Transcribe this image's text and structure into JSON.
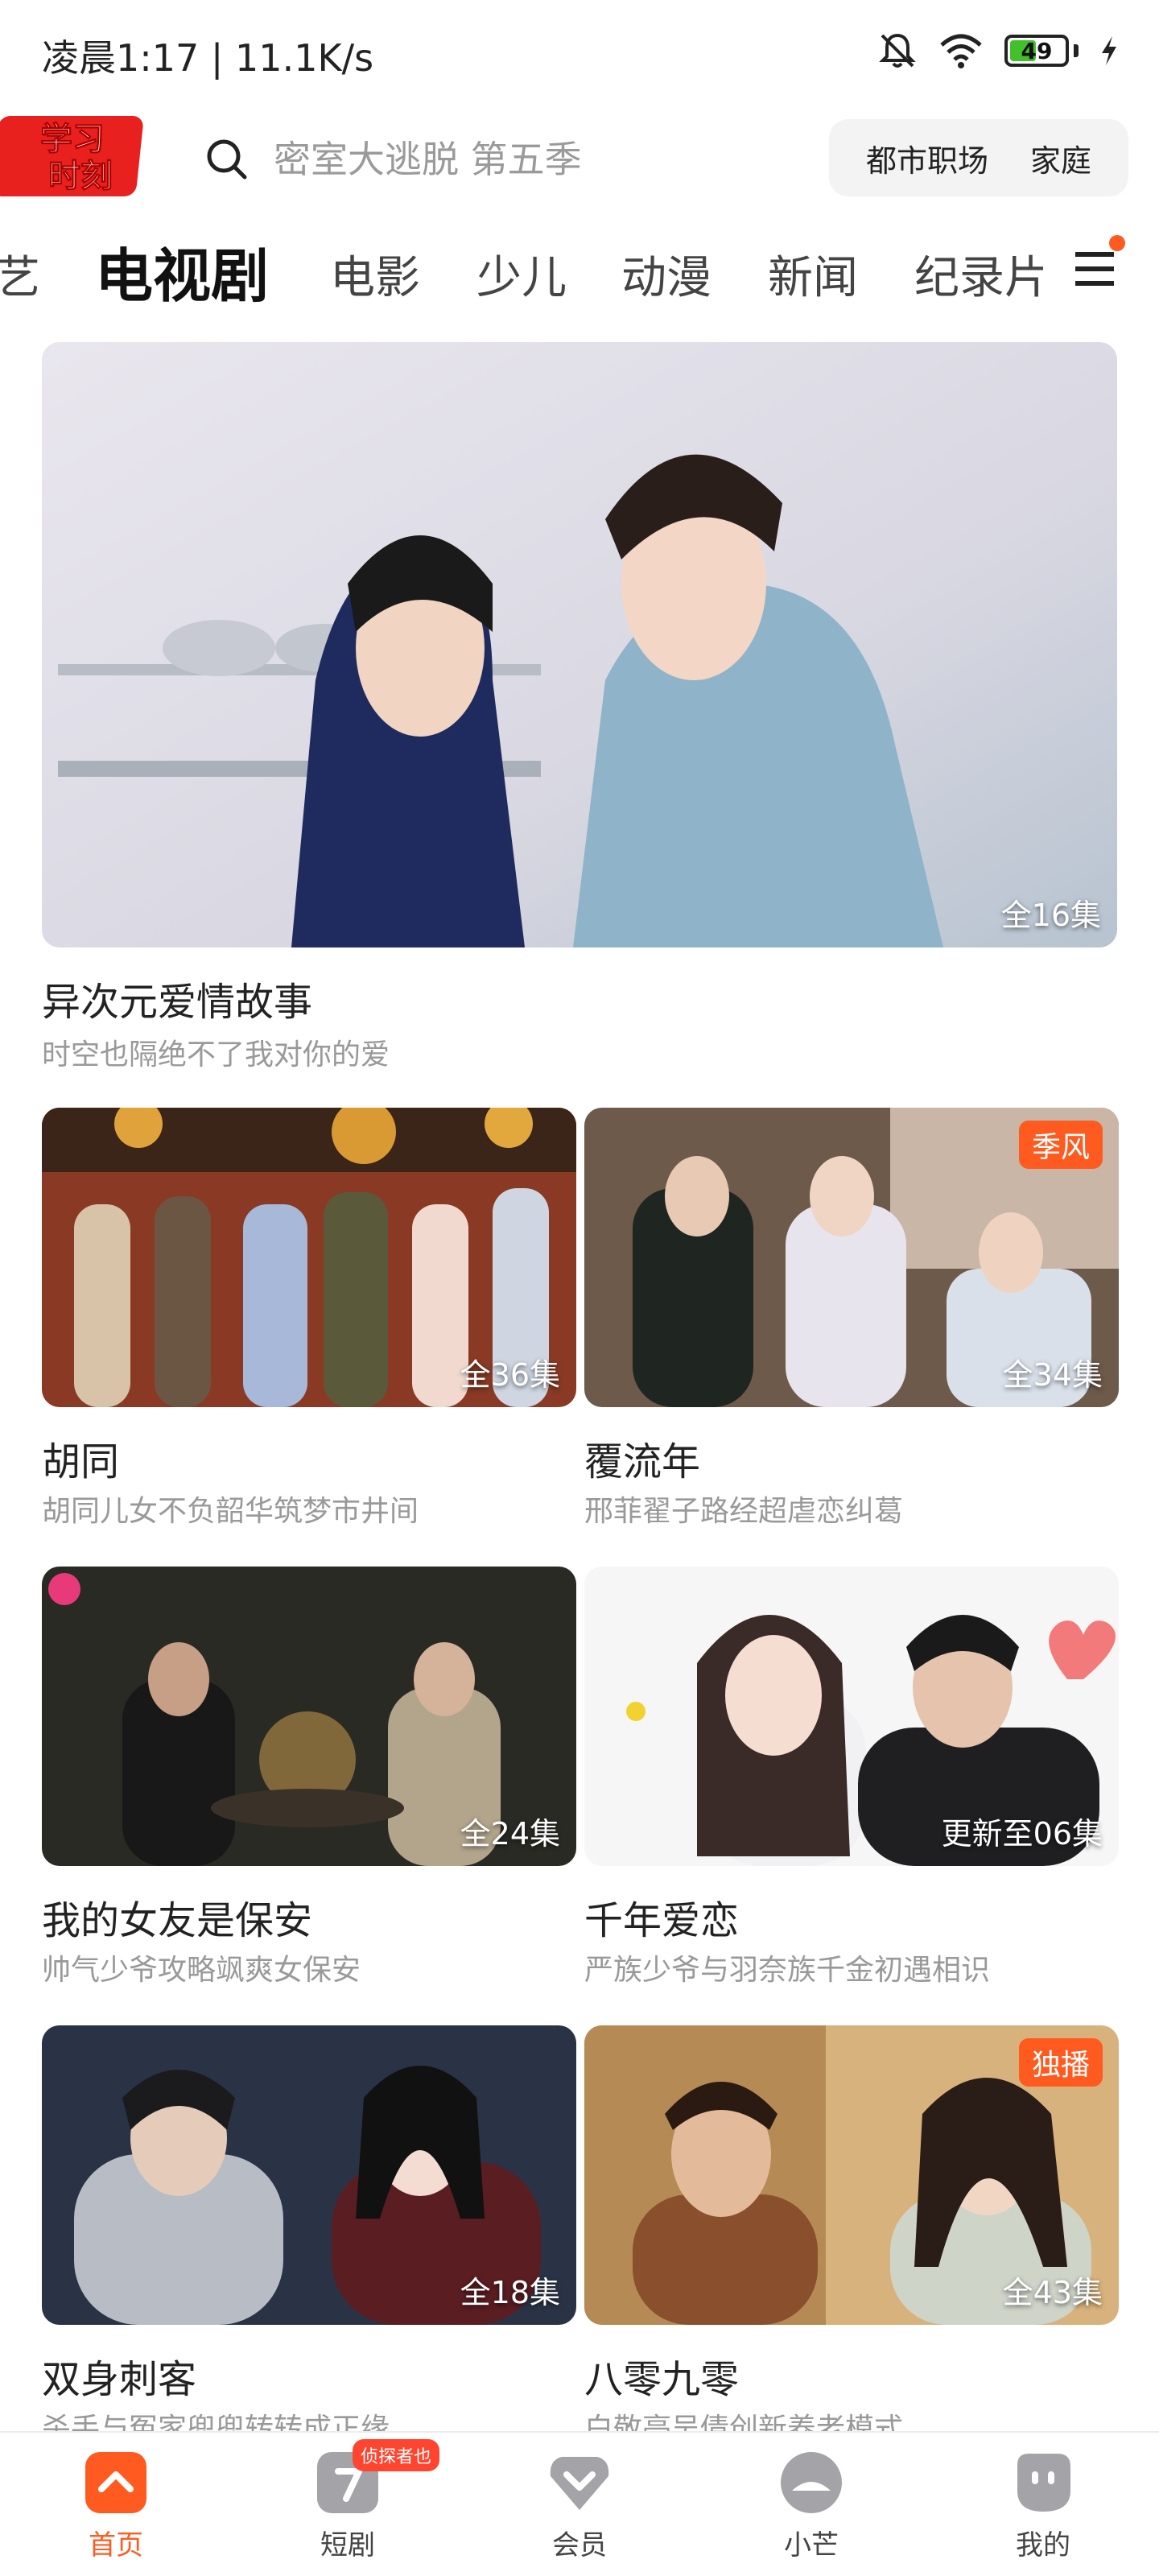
{
  "status_bar": {
    "time_speed": "凌晨1:17 | 11.1K/s",
    "battery": "49",
    "battery_level": 0.49
  },
  "header": {
    "logo_text": "学习时刻",
    "search_placeholder": "密室大逃脱 第五季",
    "tags": [
      "都市职场",
      "家庭"
    ]
  },
  "tabs": [
    "艺",
    "电视剧",
    "电影",
    "少儿",
    "动漫",
    "新闻",
    "纪录片"
  ],
  "featured": {
    "title": "异次元爱情故事",
    "subtitle": "时空也隔绝不了我对你的爱",
    "episodes": "全16集"
  },
  "grid": [
    {
      "title": "胡同",
      "subtitle": "胡同儿女不负韶华筑梦市井间",
      "episodes": "全36集",
      "badge": ""
    },
    {
      "title": "覆流年",
      "subtitle": "邢菲翟子路经超虐恋纠葛",
      "episodes": "全34集",
      "badge": "季风"
    },
    {
      "title": "我的女友是保安",
      "subtitle": "帅气少爷攻略飒爽女保安",
      "episodes": "全24集",
      "badge": ""
    },
    {
      "title": "千年爱恋",
      "subtitle": "严族少爷与羽奈族千金初遇相识",
      "episodes": "更新至06集",
      "badge": ""
    },
    {
      "title": "双身刺客",
      "subtitle": "杀手与冤家兜兜转转成正缘",
      "episodes": "全18集",
      "badge": ""
    },
    {
      "title": "八零九零",
      "subtitle": "白敬亭吴倩创新养老模式",
      "episodes": "全43集",
      "badge": "独播"
    }
  ],
  "bottom_nav": {
    "items": [
      "首页",
      "短剧",
      "会员",
      "小芒",
      "我的"
    ],
    "short_badge": "侦探者也"
  },
  "colors": {
    "accent": "#ff5a1f"
  }
}
